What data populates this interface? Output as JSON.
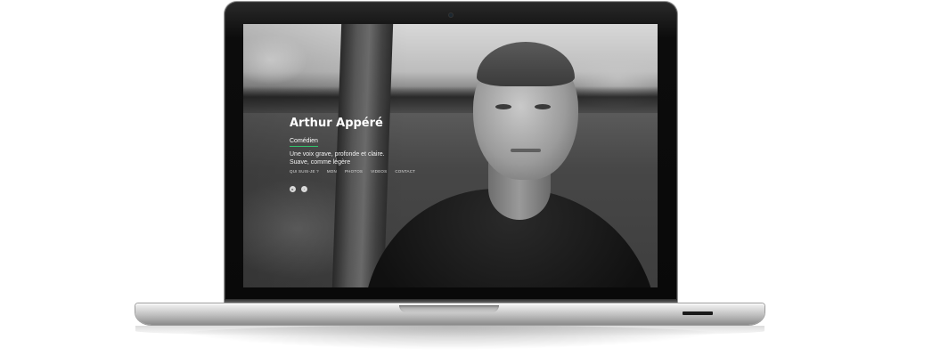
{
  "site": {
    "name": "Arthur Appéré",
    "role": "Comédien",
    "tagline_line1": "Une voix grave, profonde et claire.",
    "tagline_line2": "Suave, comme légère",
    "nav": [
      "QUI SUIS-JE ?",
      "MON",
      "PHOTOS",
      "VIDEOS",
      "CONTACT"
    ],
    "social_icons": [
      "youtube-icon",
      "instagram-icon"
    ]
  },
  "colors": {
    "accent": "#32c36c",
    "laptop_bezel": "#0c0c0c",
    "laptop_aluminium": "#c8c8c8"
  }
}
